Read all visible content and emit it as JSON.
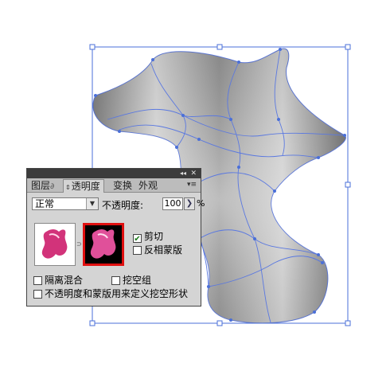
{
  "panel": {
    "tabs": [
      {
        "label": "图层"
      },
      {
        "label": "透明度"
      },
      {
        "label": "变换"
      },
      {
        "label": "外观"
      }
    ],
    "collapse_glyph": "◂◂",
    "close_glyph": "✕",
    "menu_glyph": "▾≡",
    "blend_mode": "正常",
    "opacity_label": "不透明度:",
    "opacity_value": "100",
    "percent_sign": "%",
    "clip_label": "剪切",
    "clip_checked": true,
    "invert_mask_label": "反相蒙版",
    "invert_mask_checked": false,
    "isolate_blend_label": "隔离混合",
    "isolate_blend_checked": false,
    "knockout_group_label": "挖空组",
    "knockout_group_checked": false,
    "opacity_mask_knockout_label": "不透明度和蒙版用来定义挖空形状",
    "opacity_mask_knockout_checked": false
  },
  "colors": {
    "selection_blue": "#4a6fd8",
    "mask_border_red": "#e01010",
    "thumbnail_pink": "#d2337a"
  }
}
